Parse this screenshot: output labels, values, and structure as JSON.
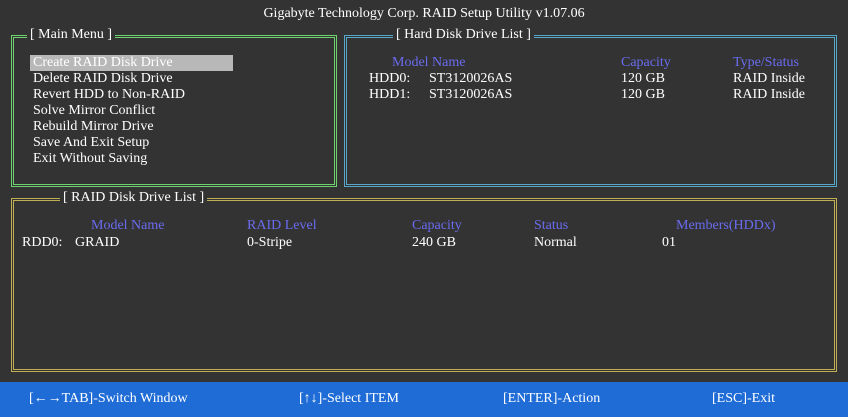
{
  "title": "Gigabyte Technology Corp.  RAID Setup Utility  v1.07.06",
  "colors": {
    "background": "#333333",
    "main_menu_border": "#6ed36e",
    "hdd_border": "#56a7c9",
    "raid_border": "#c2ae52",
    "header_text": "#6a6cf0",
    "selection": "#b8b8b8",
    "footer": "#1f6cd6"
  },
  "main_menu": {
    "title": "[ Main Menu ]",
    "items": [
      {
        "label": "Create RAID Disk Drive",
        "selected": true
      },
      {
        "label": "Delete RAID Disk Drive",
        "selected": false
      },
      {
        "label": "Revert HDD to Non-RAID",
        "selected": false
      },
      {
        "label": "Solve Mirror Conflict",
        "selected": false
      },
      {
        "label": "Rebuild Mirror Drive",
        "selected": false
      },
      {
        "label": "Save And Exit Setup",
        "selected": false
      },
      {
        "label": "Exit Without Saving",
        "selected": false
      }
    ]
  },
  "hdd_list": {
    "title": "[ Hard Disk Drive List ]",
    "headers": {
      "model": "Model Name",
      "capacity": "Capacity",
      "type": "Type/Status"
    },
    "rows": [
      {
        "id": "HDD0:",
        "model": "ST3120026AS",
        "capacity": "120 GB",
        "type": "RAID Inside"
      },
      {
        "id": "HDD1:",
        "model": "ST3120026AS",
        "capacity": "120 GB",
        "type": "RAID Inside"
      }
    ]
  },
  "raid_list": {
    "title": "[ RAID Disk Drive List ]",
    "headers": {
      "model": "Model Name",
      "level": "RAID Level",
      "capacity": "Capacity",
      "status": "Status",
      "members": "Members(HDDx)"
    },
    "rows": [
      {
        "id": "RDD0:",
        "model": "GRAID",
        "level": "0-Stripe",
        "capacity": "240 GB",
        "status": "Normal",
        "members": "01"
      }
    ]
  },
  "footer": {
    "switch": "[←→TAB]-Switch Window",
    "select": "[↑↓]-Select ITEM",
    "action": "[ENTER]-Action",
    "exit": "[ESC]-Exit"
  }
}
